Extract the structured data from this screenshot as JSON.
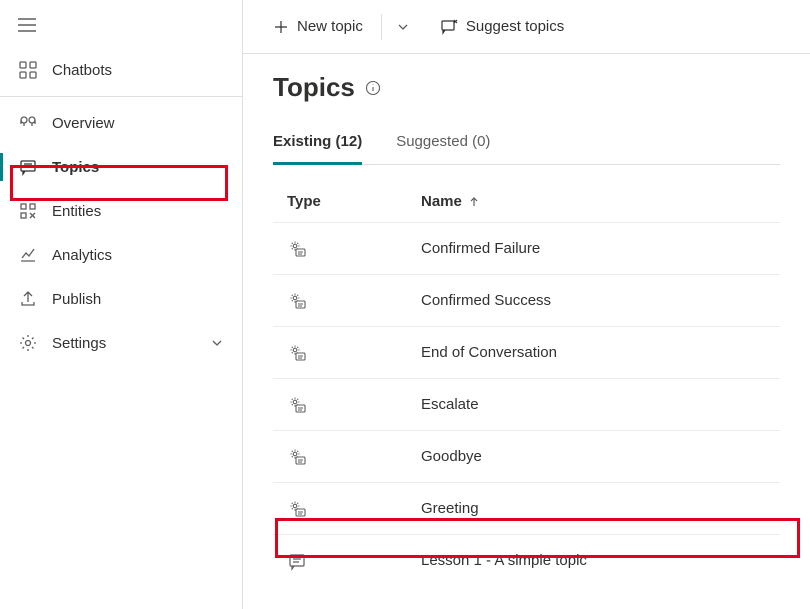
{
  "sidebar": {
    "items": [
      {
        "label": "Chatbots"
      },
      {
        "label": "Overview"
      },
      {
        "label": "Topics"
      },
      {
        "label": "Entities"
      },
      {
        "label": "Analytics"
      },
      {
        "label": "Publish"
      },
      {
        "label": "Settings"
      }
    ]
  },
  "cmdbar": {
    "new_topic": "New topic",
    "suggest_topics": "Suggest topics"
  },
  "page": {
    "title": "Topics"
  },
  "tabs": {
    "existing_label": "Existing (12)",
    "suggested_label": "Suggested (0)"
  },
  "table": {
    "headers": {
      "type": "Type",
      "name": "Name"
    },
    "rows": [
      {
        "name": "Confirmed Failure",
        "icon": "system"
      },
      {
        "name": "Confirmed Success",
        "icon": "system"
      },
      {
        "name": "End of Conversation",
        "icon": "system"
      },
      {
        "name": "Escalate",
        "icon": "system"
      },
      {
        "name": "Goodbye",
        "icon": "system"
      },
      {
        "name": "Greeting",
        "icon": "system"
      },
      {
        "name": "Lesson 1 - A simple topic",
        "icon": "user"
      }
    ]
  }
}
